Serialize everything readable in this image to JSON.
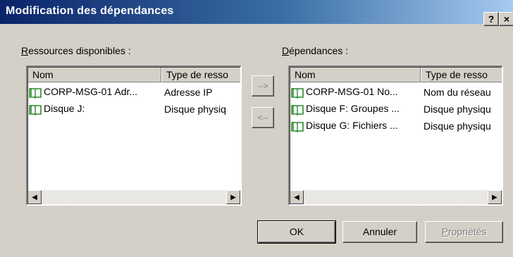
{
  "window": {
    "title": "Modification des dépendances",
    "help_button": "?",
    "close_button": "×"
  },
  "available": {
    "label": "Ressources disponibles :",
    "accel": "R",
    "label_rest": "essources disponibles :",
    "columns": [
      "Nom",
      "Type de resso"
    ],
    "items": [
      {
        "icon": "book-icon",
        "name": "CORP-MSG-01 Adr...",
        "type": "Adresse IP"
      },
      {
        "icon": "book-icon",
        "name": "Disque J:",
        "type": "Disque physiq"
      }
    ]
  },
  "dependencies": {
    "label": "Dépendances :",
    "accel": "D",
    "label_rest": "épendances :",
    "columns": [
      "Nom",
      "Type de resso"
    ],
    "items": [
      {
        "icon": "book-icon",
        "name": "CORP-MSG-01 No...",
        "type": "Nom du réseau"
      },
      {
        "icon": "book-icon",
        "name": "Disque F: Groupes ...",
        "type": "Disque physiqu"
      },
      {
        "icon": "book-icon",
        "name": "Disque G: Fichiers ...",
        "type": "Disque physiqu"
      }
    ]
  },
  "transfer": {
    "add_label": "-->",
    "remove_label": "<--"
  },
  "buttons": {
    "ok": "OK",
    "cancel": "Annuler",
    "properties": "Propriétés",
    "properties_accel": "P",
    "properties_rest": "ropriétés"
  },
  "colors": {
    "titlebar_start": "#0a246a",
    "titlebar_end": "#a6caf0",
    "dialog_bg": "#d4d0c8",
    "icon_green": "#2f8a2f"
  }
}
